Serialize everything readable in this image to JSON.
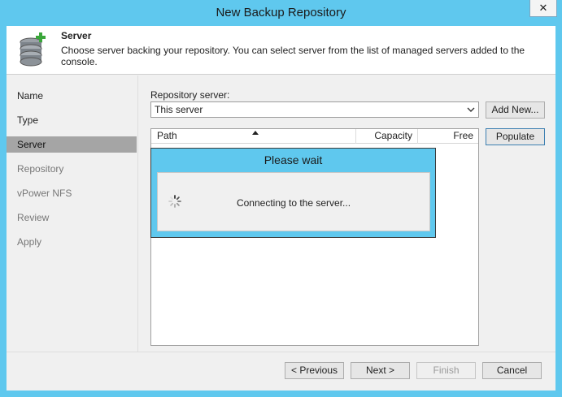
{
  "window": {
    "title": "New Backup Repository",
    "close_label": "✕"
  },
  "header": {
    "title": "Server",
    "description": "Choose server backing your repository. You can select server from the list of managed servers added to the console."
  },
  "steps": [
    {
      "label": "Name",
      "state": "visited"
    },
    {
      "label": "Type",
      "state": "visited"
    },
    {
      "label": "Server",
      "state": "active"
    },
    {
      "label": "Repository",
      "state": "pending"
    },
    {
      "label": "vPower NFS",
      "state": "pending"
    },
    {
      "label": "Review",
      "state": "pending"
    },
    {
      "label": "Apply",
      "state": "pending"
    }
  ],
  "server": {
    "label": "Repository server:",
    "selected": "This server",
    "add_new_label": "Add New...",
    "populate_label": "Populate"
  },
  "grid": {
    "columns": [
      "Path",
      "Capacity",
      "Free"
    ]
  },
  "wait": {
    "title": "Please wait",
    "message": "Connecting to the server..."
  },
  "footer": {
    "previous_label": "< Previous",
    "next_label": "Next >",
    "finish_label": "Finish",
    "cancel_label": "Cancel"
  },
  "colors": {
    "accent": "#5fc8ee",
    "active_step": "#a5a5a5",
    "icon_plus": "#3aa63a"
  }
}
